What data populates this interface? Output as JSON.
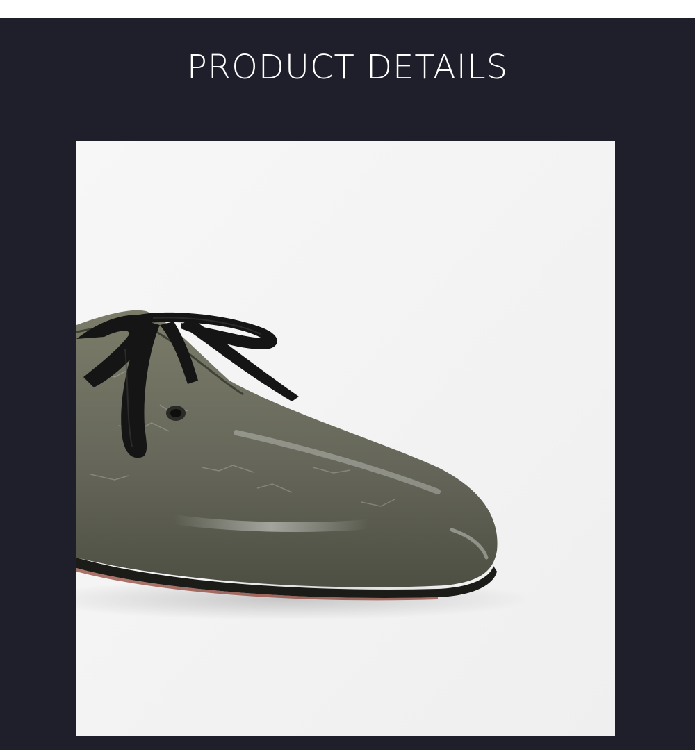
{
  "section": {
    "title": "PRODUCT DETAILS"
  },
  "product_image": {
    "subject": "olive-patent-leather-lace-up-flat-toe",
    "colors": {
      "background": "#1f1f2b",
      "photo_background": "#f4f4f4",
      "leather": "#6b6c5a",
      "ribbon": "#141414"
    }
  }
}
